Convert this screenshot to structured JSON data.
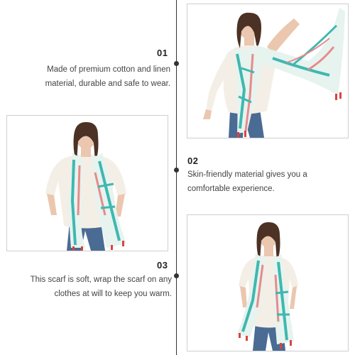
{
  "features": [
    {
      "number": "01",
      "lines": [
        "Made of premium cotton and linen",
        "material, durable and safe to wear."
      ]
    },
    {
      "number": "02",
      "lines": [
        "Skin-friendly material gives you a",
        "comfortable experience."
      ]
    },
    {
      "number": "03",
      "lines": [
        "This  scarf is soft, wrap the scarf on any",
        "clothes at will to keep you warm."
      ]
    }
  ],
  "photos": [
    {
      "subject": "woman-with-floral-scarf-photo",
      "pose": "arm raised, scarf flying"
    },
    {
      "subject": "woman-with-floral-scarf-photo",
      "pose": "scarf draped over shoulders"
    },
    {
      "subject": "woman-with-floral-scarf-photo",
      "pose": "scarf draped over shoulders"
    }
  ],
  "colors": {
    "line": "#333333",
    "text": "#444444",
    "scarf_teal": "#3fb8b0",
    "scarf_pink": "#e98a8a",
    "tassel": "#d9443f",
    "jeans": "#4a6c94",
    "top": "#f4efe6",
    "hair": "#4b3224"
  }
}
